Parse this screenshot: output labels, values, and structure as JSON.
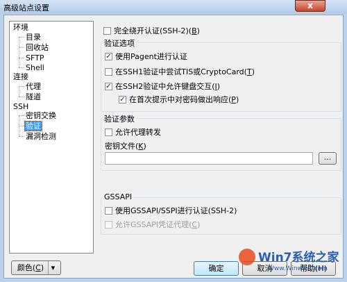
{
  "window": {
    "title": "高级站点设置",
    "close_glyph": "x"
  },
  "tree": {
    "items": [
      {
        "label": "环境"
      },
      {
        "label": "目录"
      },
      {
        "label": "回收站"
      },
      {
        "label": "SFTP"
      },
      {
        "label": "Shell"
      },
      {
        "label": "连接"
      },
      {
        "label": "代理"
      },
      {
        "label": "隧道"
      },
      {
        "label": "SSH"
      },
      {
        "label": "密钥交换"
      },
      {
        "label": "验证"
      },
      {
        "label": "漏洞检测"
      }
    ]
  },
  "panel": {
    "bypass_auth": {
      "label": "完全绕开认证(SSH-2)(",
      "key": "B",
      "suffix": ")",
      "checked": false
    },
    "auth_group": {
      "title": "验证选项",
      "pagent": {
        "label": "使用Pagent进行认证",
        "checked": true
      },
      "tis": {
        "label": "在SSH1验证中尝试TIS或CryptoCard(",
        "key": "T",
        "suffix": ")",
        "checked": false
      },
      "keyboard": {
        "label": "在SSH2验证中允许键盘交互(",
        "key": "I",
        "suffix": ")",
        "checked": true
      },
      "first_prompt": {
        "label": "在首次提示中对密码做出响应(",
        "key": "P",
        "suffix": ")",
        "checked": true
      }
    },
    "auth_params": {
      "title": "验证参数",
      "agent_forward": {
        "label": "允许代理转发",
        "checked": false
      },
      "keyfile_label": "密钥文件(",
      "keyfile_key": "K",
      "keyfile_suffix": ")",
      "keyfile_value": "",
      "browse_label": "..."
    },
    "gssapi": {
      "title": "GSSAPI",
      "use": {
        "label": "使用GSSAPI/SSPI进行认证(SSH-2)",
        "checked": false
      },
      "delegate": {
        "label": "允许GSSAPI凭证代理(",
        "key": "C",
        "suffix": ")",
        "checked": false
      }
    }
  },
  "buttons": {
    "color": "颜色(",
    "color_key": "C",
    "color_suffix": ")",
    "dropdown_glyph": "▾",
    "ok": "确定",
    "cancel": "取消",
    "help": "帮助(H)"
  },
  "watermark": {
    "text": "Win7系统之家",
    "url": "Www.Winwin7.com"
  }
}
